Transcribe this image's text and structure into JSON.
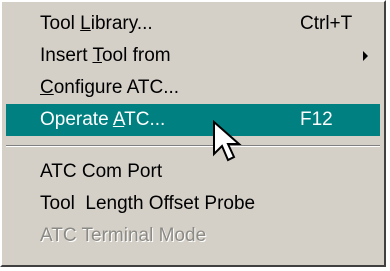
{
  "menu": {
    "items": [
      {
        "pre": "Tool ",
        "mnemonic": "L",
        "post": "ibrary...",
        "shortcut": "Ctrl+T"
      },
      {
        "pre": "Insert ",
        "mnemonic": "T",
        "post": "ool from"
      },
      {
        "pre": "",
        "mnemonic": "C",
        "post": "onfigure ATC..."
      },
      {
        "pre": "Operate ",
        "mnemonic": "A",
        "post": "TC...",
        "shortcut": "F12"
      },
      {
        "label": "ATC Com Port"
      },
      {
        "label": "Tool  Length Offset Probe"
      },
      {
        "label": "ATC Terminal Mode"
      }
    ],
    "selected_index": 3,
    "disabled_index": 6
  },
  "icons": {
    "submenu_arrow": "chevron-right-icon",
    "cursor": "mouse-pointer-icon"
  },
  "colors": {
    "menu_bg": "#d4d0c8",
    "highlight_bg": "#008080",
    "highlight_text": "#ffffff",
    "disabled_text": "#8c8a84"
  }
}
